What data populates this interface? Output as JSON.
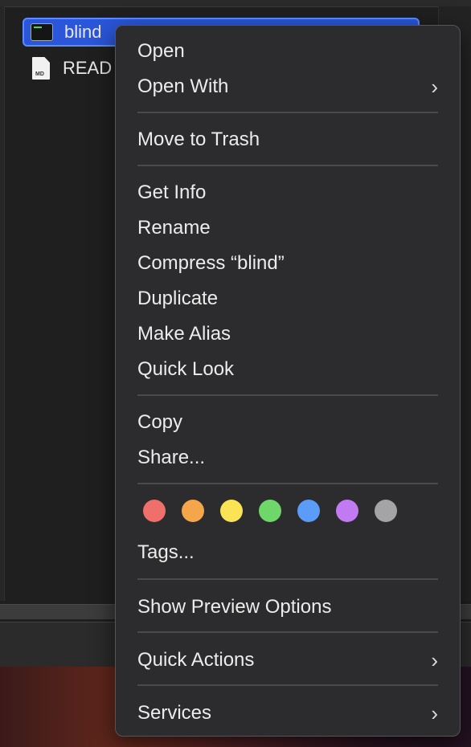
{
  "files": [
    {
      "name": "blind",
      "selected": true,
      "icon": "terminal-executable-icon"
    },
    {
      "name": "READ",
      "selected": false,
      "icon": "markdown-file-icon",
      "badge": "MD"
    }
  ],
  "menu": {
    "open": "Open",
    "open_with": "Open With",
    "move_to_trash": "Move to Trash",
    "get_info": "Get Info",
    "rename": "Rename",
    "compress": "Compress “blind”",
    "duplicate": "Duplicate",
    "make_alias": "Make Alias",
    "quick_look": "Quick Look",
    "copy": "Copy",
    "share": "Share...",
    "tags": "Tags...",
    "show_preview_options": "Show Preview Options",
    "quick_actions": "Quick Actions",
    "services": "Services",
    "chevron": "›"
  },
  "tag_colors": [
    {
      "name": "red",
      "color": "#ef6f6b"
    },
    {
      "name": "orange",
      "color": "#f5a54a"
    },
    {
      "name": "yellow",
      "color": "#fbe356"
    },
    {
      "name": "green",
      "color": "#6fd66a"
    },
    {
      "name": "blue",
      "color": "#5a9cf7"
    },
    {
      "name": "purple",
      "color": "#c27af3"
    },
    {
      "name": "gray",
      "color": "#a4a4a6"
    }
  ]
}
